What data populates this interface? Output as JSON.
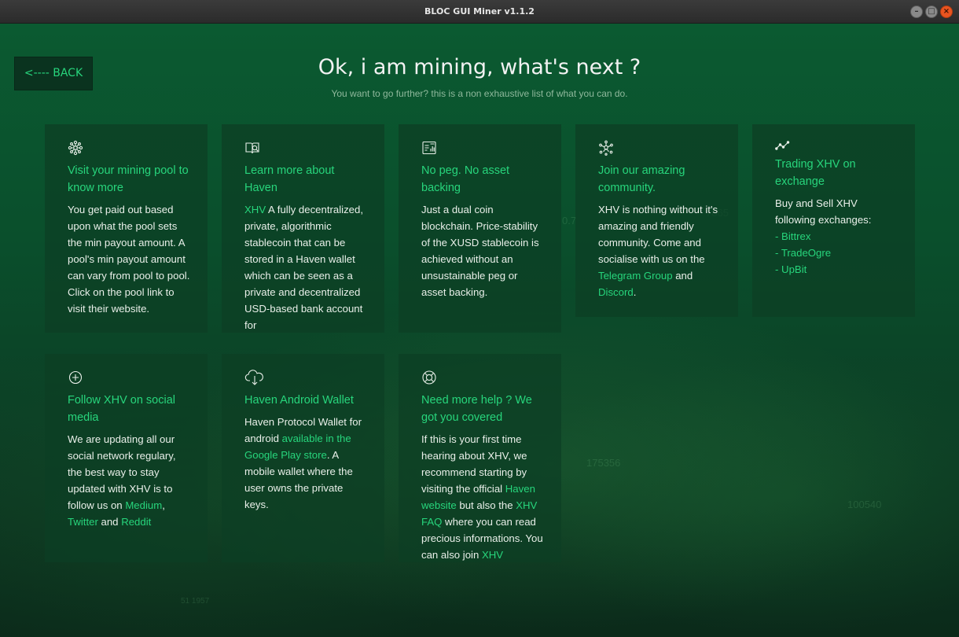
{
  "window": {
    "title": "BLOC GUI Miner v1.1.2",
    "minimize": "–",
    "maximize": "□",
    "close": "×"
  },
  "back_label": "<---- BACK",
  "heading": "Ok, i am mining, what's next ?",
  "subheading": "You want to go further? this is a non exhaustive list of what you can do.",
  "bg_numbers": [
    "0.7",
    "7865",
    "175356",
    "100540",
    "51 1957"
  ],
  "cards": {
    "pool": {
      "icon": "network-icon",
      "title": "Visit your mining pool to know more",
      "body": "You get paid out based upon what the pool sets the min payout amount. A pool's min payout amount can vary from pool to pool. Click on the pool link to visit their website."
    },
    "haven": {
      "icon": "book-search-icon",
      "title": "Learn more about Haven",
      "link": "XHV",
      "body": " A fully decentralized, private, algorithmic stablecoin that can be stored in a Haven wallet which can be seen as a private and decentralized USD-based bank account for"
    },
    "peg": {
      "icon": "chart-board-icon",
      "title": "No peg. No asset backing",
      "body": "Just a dual coin blockchain. Price-stability of the XUSD stablecoin is achieved without an unsustainable peg or asset backing."
    },
    "community": {
      "icon": "community-icon",
      "title": "Join our amazing community.",
      "body": "XHV is nothing without it's amazing and friendly community. Come and socialise with us on the ",
      "link1": "Telegram Group",
      "and": " and ",
      "link2": "Discord",
      "end": "."
    },
    "exchange": {
      "icon": "trend-line-icon",
      "title": "Trading XHV on exchange",
      "body": "Buy and Sell XHV following exchanges:",
      "links": [
        "- Bittrex",
        "- TradeOgre",
        "- UpBit"
      ]
    },
    "social": {
      "icon": "plus-circle-icon",
      "title": "Follow XHV on social media",
      "body": "We are updating all our social network regulary, the best way to stay updated with XHV is to follow us on ",
      "link1": "Medium",
      "comma": ", ",
      "link2": "Twitter",
      "and": " and ",
      "link3": "Reddit"
    },
    "android": {
      "icon": "cloud-download-icon",
      "title": "Haven Android Wallet",
      "body1": "Haven Protocol Wallet for android ",
      "link": "available in the Google Play store",
      "body2": ". A mobile wallet where the user owns the private keys."
    },
    "help": {
      "icon": "lifebuoy-icon",
      "title": "Need more help ? We got you covered",
      "body1": "If this is your first time hearing about XHV, we recommend starting by visiting the official ",
      "link1": "Haven website",
      "body2": " but also the ",
      "link2": "XHV FAQ",
      "body3": " where you can read precious informations. You can also join ",
      "link3": "XHV"
    }
  },
  "colors": {
    "accent": "#27d57c",
    "text": "#e9efe9",
    "card": "#0c3e24"
  }
}
